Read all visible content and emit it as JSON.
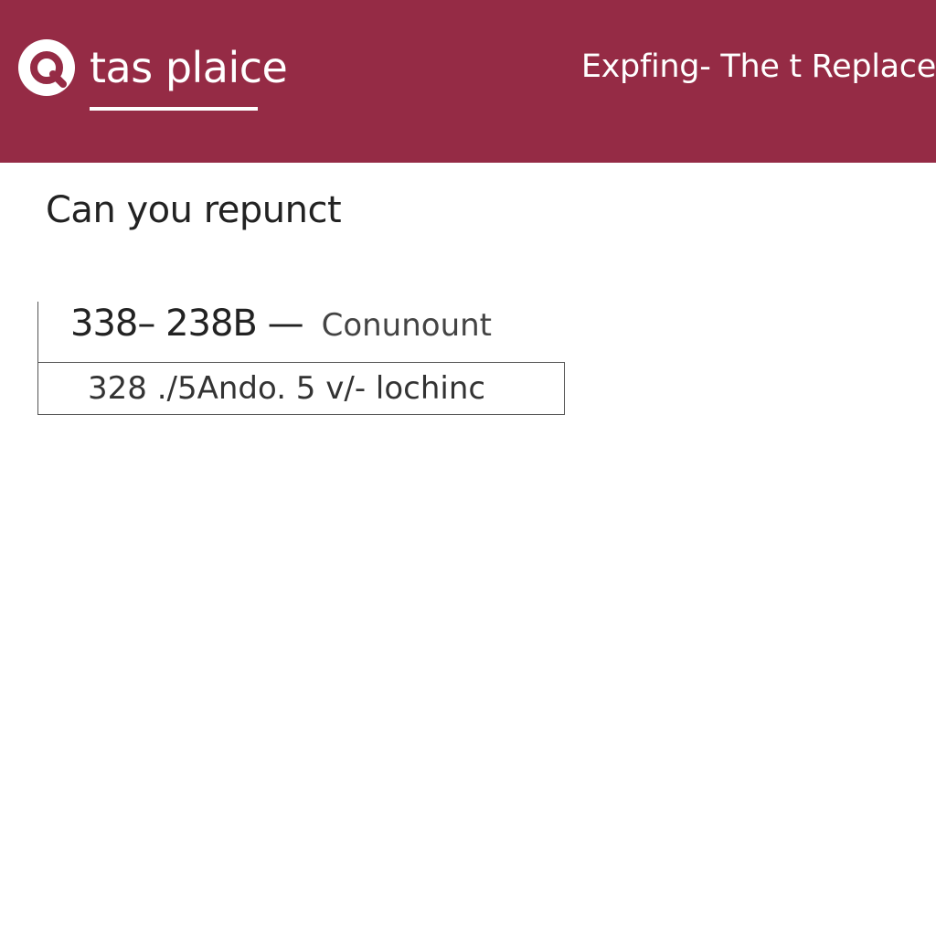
{
  "colors": {
    "header_background": "#952b45",
    "header_text": "#ffffff",
    "page_background": "#ffffff",
    "body_text": "#222222"
  },
  "header": {
    "logo_icon": "magnifier-q-icon",
    "brand_name": "tas plaice",
    "nav_link": "Expfing- The t Replace"
  },
  "main": {
    "heading": "Can you repunct",
    "rows": [
      {
        "value": "338– 238B —",
        "label": "Conunount"
      },
      {
        "text": "328 ./5Ando. 5 v/- lochinc"
      }
    ]
  }
}
